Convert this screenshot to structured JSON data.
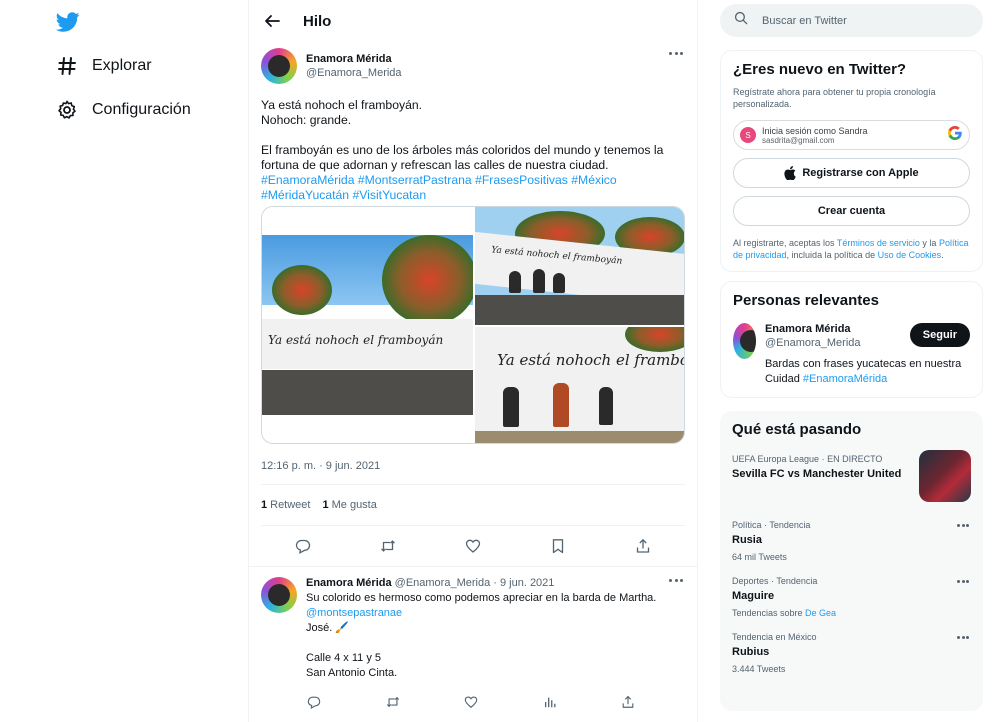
{
  "nav": {
    "explore_label": "Explorar",
    "settings_label": "Configuración"
  },
  "header": {
    "title": "Hilo"
  },
  "tweet": {
    "author_name": "Enamora Mérida",
    "author_handle": "@Enamora_Merida",
    "text_line1": "Ya está nohoch el framboyán.",
    "text_line2": "Nohoch: grande.",
    "text_para2": "El framboyán es uno de los árboles más coloridos del mundo y tenemos la fortuna de que adornan y refrescan las calles de nuestra ciudad.",
    "hashtags": [
      "#EnamoraMérida",
      "#MontserratPastrana",
      "#FrasesPositivas",
      "#México",
      "#MéridaYucatán",
      "#VisitYucatan"
    ],
    "mural_text": "Ya está nohoch el framboyán",
    "timestamp": "12:16 p. m. · 9 jun. 2021",
    "retweets_count": "1",
    "retweets_label": "Retweet",
    "likes_count": "1",
    "likes_label": "Me gusta"
  },
  "reply": {
    "author_name": "Enamora Mérida",
    "meta": "@Enamora_Merida · 9 jun. 2021",
    "line1": "Su colorido es hermoso como podemos apreciar en la barda de Martha.",
    "mention": "@montsepastranae",
    "line3": "José. 🖌️",
    "line4": "Calle 4 x 11 y 5",
    "line5": "San Antonio Cinta."
  },
  "search": {
    "placeholder": "Buscar en Twitter"
  },
  "signup": {
    "title": "¿Eres nuevo en Twitter?",
    "desc": "Regístrate ahora para obtener tu propia cronología personalizada.",
    "google_line1": "Inicia sesión como Sandra",
    "google_line2": "sasdrita@gmail.com",
    "google_initial": "S",
    "apple_label": "Registrarse con Apple",
    "create_label": "Crear cuenta",
    "legal_prefix": "Al registrarte, aceptas los ",
    "legal_terms": "Términos de servicio",
    "legal_mid": " y la ",
    "legal_privacy": "Política de privacidad",
    "legal_mid2": ", incluida la política de ",
    "legal_cookies": "Uso de Cookies",
    "legal_end": "."
  },
  "relevant": {
    "title": "Personas relevantes",
    "name": "Enamora Mérida",
    "handle": "@Enamora_Merida",
    "bio": "Bardas con frases yucatecas en nuestra Cuidad ",
    "bio_tag": "#EnamoraMérida",
    "follow_label": "Seguir"
  },
  "trends": {
    "title": "Qué está pasando",
    "event_meta": "UEFA Europa League · EN DIRECTO",
    "event_title": "Sevilla FC vs Manchester United",
    "items": [
      {
        "meta": "Política · Tendencia",
        "title": "Rusia",
        "count": "64 mil Tweets"
      },
      {
        "meta": "Deportes · Tendencia",
        "title": "Maguire",
        "count_prefix": "Tendencias sobre ",
        "count_link": "De Gea"
      },
      {
        "meta": "Tendencia en México",
        "title": "Rubius",
        "count": "3.444 Tweets"
      }
    ]
  },
  "colors": {
    "accent": "#1d9bf0",
    "text": "#0f1419",
    "secondary": "#536471",
    "border": "#eff3f4"
  }
}
